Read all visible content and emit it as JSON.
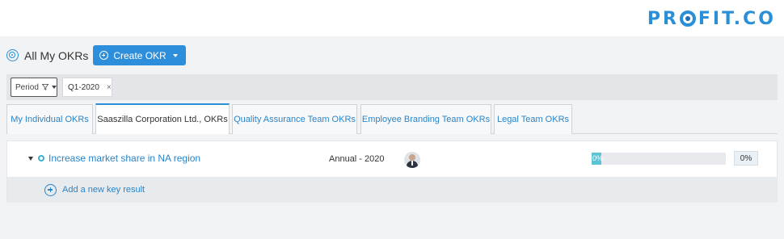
{
  "brand": {
    "logo_text_left": "PR",
    "logo_text_right": "FIT.CO",
    "color": "#2a8fd6"
  },
  "header": {
    "title": "All My OKRs",
    "create_button_label": "Create OKR"
  },
  "filters": {
    "period_label": "Period",
    "chips": [
      {
        "label": "Q1-2020",
        "remove_glyph": "×"
      }
    ]
  },
  "tabs": [
    {
      "label": "My Individual OKRs",
      "active": false
    },
    {
      "label": "Saaszilla Corporation Ltd., OKRs",
      "active": true
    },
    {
      "label": "Quality Assurance Team OKRs",
      "active": false
    },
    {
      "label": "Employee Branding Team OKRs",
      "active": false
    },
    {
      "label": "Legal Team OKRs",
      "active": false
    }
  ],
  "objectives": [
    {
      "title": "Increase market share in NA region",
      "period": "Annual - 2020",
      "progress_percent": 0,
      "progress_label": "0%",
      "percent_display": "0%",
      "owner_icon": "user-avatar"
    }
  ],
  "add_key_result_label": "Add a new key result",
  "colors": {
    "accent": "#2d8fdb",
    "progress": "#5bc4d6",
    "link": "#2a84c8"
  }
}
